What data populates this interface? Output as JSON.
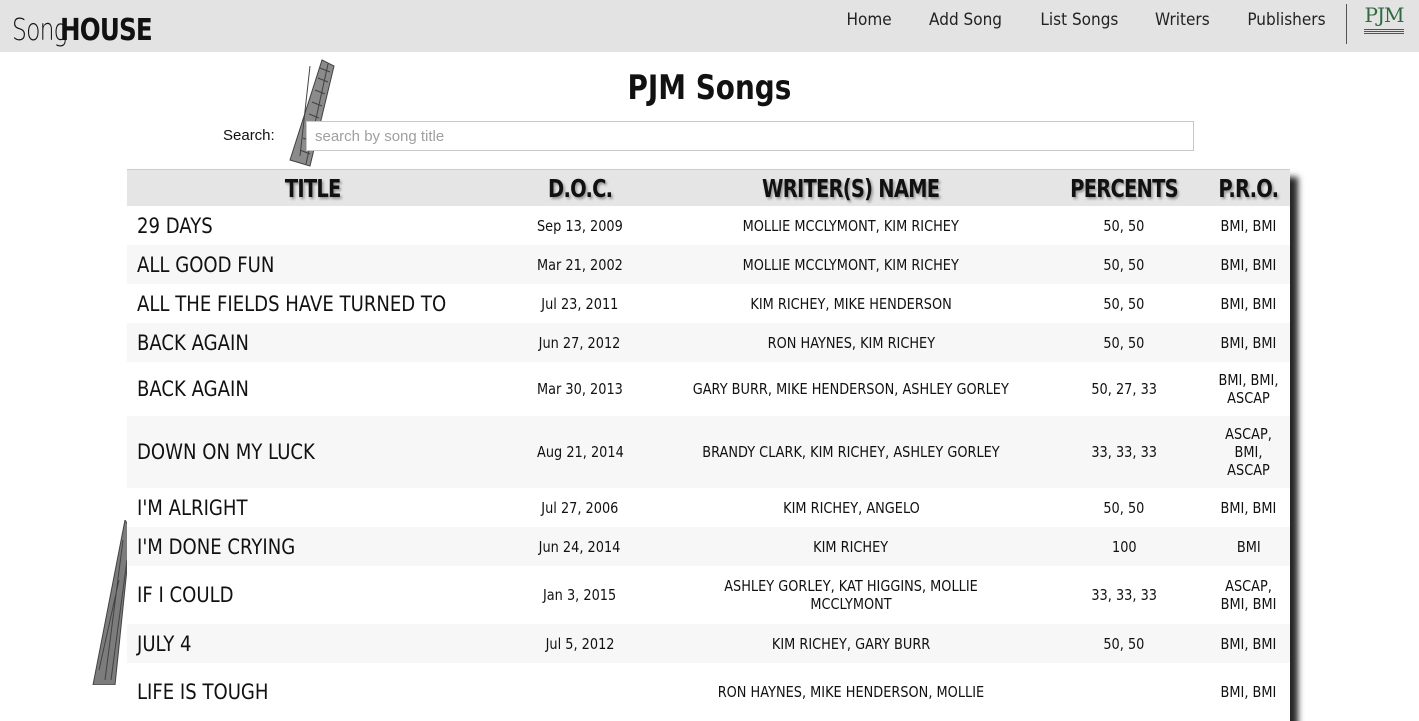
{
  "brand": {
    "song": "Song",
    "house": "HOUSE"
  },
  "nav": {
    "items": [
      "Home",
      "Add Song",
      "List Songs",
      "Writers",
      "Publishers"
    ],
    "logo_text": "PJM"
  },
  "page_title": "PJM Songs",
  "search": {
    "label": "Search:",
    "placeholder": "search by song title",
    "value": ""
  },
  "table": {
    "columns": [
      "TITLE",
      "D.O.C.",
      "WRITER(S) NAME",
      "PERCENTS",
      "P.R.O."
    ],
    "rows": [
      {
        "title": "29 DAYS",
        "doc": "Sep 13, 2009",
        "writers": "MOLLIE MCCLYMONT, KIM RICHEY",
        "percents": "50, 50",
        "pro": "BMI, BMI"
      },
      {
        "title": "ALL GOOD FUN",
        "doc": "Mar 21, 2002",
        "writers": "MOLLIE MCCLYMONT, KIM RICHEY",
        "percents": "50, 50",
        "pro": "BMI, BMI"
      },
      {
        "title": "ALL THE FIELDS HAVE TURNED TO",
        "doc": "Jul 23, 2011",
        "writers": "KIM RICHEY, MIKE HENDERSON",
        "percents": "50, 50",
        "pro": "BMI, BMI"
      },
      {
        "title": "BACK AGAIN",
        "doc": "Jun 27, 2012",
        "writers": "RON HAYNES, KIM RICHEY",
        "percents": "50, 50",
        "pro": "BMI, BMI"
      },
      {
        "title": "BACK AGAIN",
        "doc": "Mar 30, 2013",
        "writers": "GARY BURR, MIKE HENDERSON, ASHLEY GORLEY",
        "percents": "50, 27, 33",
        "pro": "BMI, BMI, ASCAP"
      },
      {
        "title": "DOWN ON MY LUCK",
        "doc": "Aug 21, 2014",
        "writers": "BRANDY CLARK, KIM RICHEY, ASHLEY GORLEY",
        "percents": "33, 33, 33",
        "pro": "ASCAP, BMI, ASCAP"
      },
      {
        "title": "I'M ALRIGHT",
        "doc": "Jul 27, 2006",
        "writers": "KIM RICHEY, ANGELO",
        "percents": "50, 50",
        "pro": "BMI, BMI"
      },
      {
        "title": "I'M DONE CRYING",
        "doc": "Jun 24, 2014",
        "writers": "KIM RICHEY",
        "percents": "100",
        "pro": "BMI"
      },
      {
        "title": "IF I COULD",
        "doc": "Jan 3, 2015",
        "writers": "ASHLEY GORLEY, KAT HIGGINS, MOLLIE MCCLYMONT",
        "percents": "33, 33, 33",
        "pro": "ASCAP, BMI, BMI"
      },
      {
        "title": "JULY 4",
        "doc": "Jul 5, 2012",
        "writers": "KIM RICHEY, GARY BURR",
        "percents": "50, 50",
        "pro": "BMI, BMI"
      },
      {
        "title": "LIFE IS TOUGH",
        "doc": "",
        "writers": "RON HAYNES, MIKE HENDERSON, MOLLIE",
        "percents": "",
        "pro": "BMI, BMI"
      }
    ]
  }
}
